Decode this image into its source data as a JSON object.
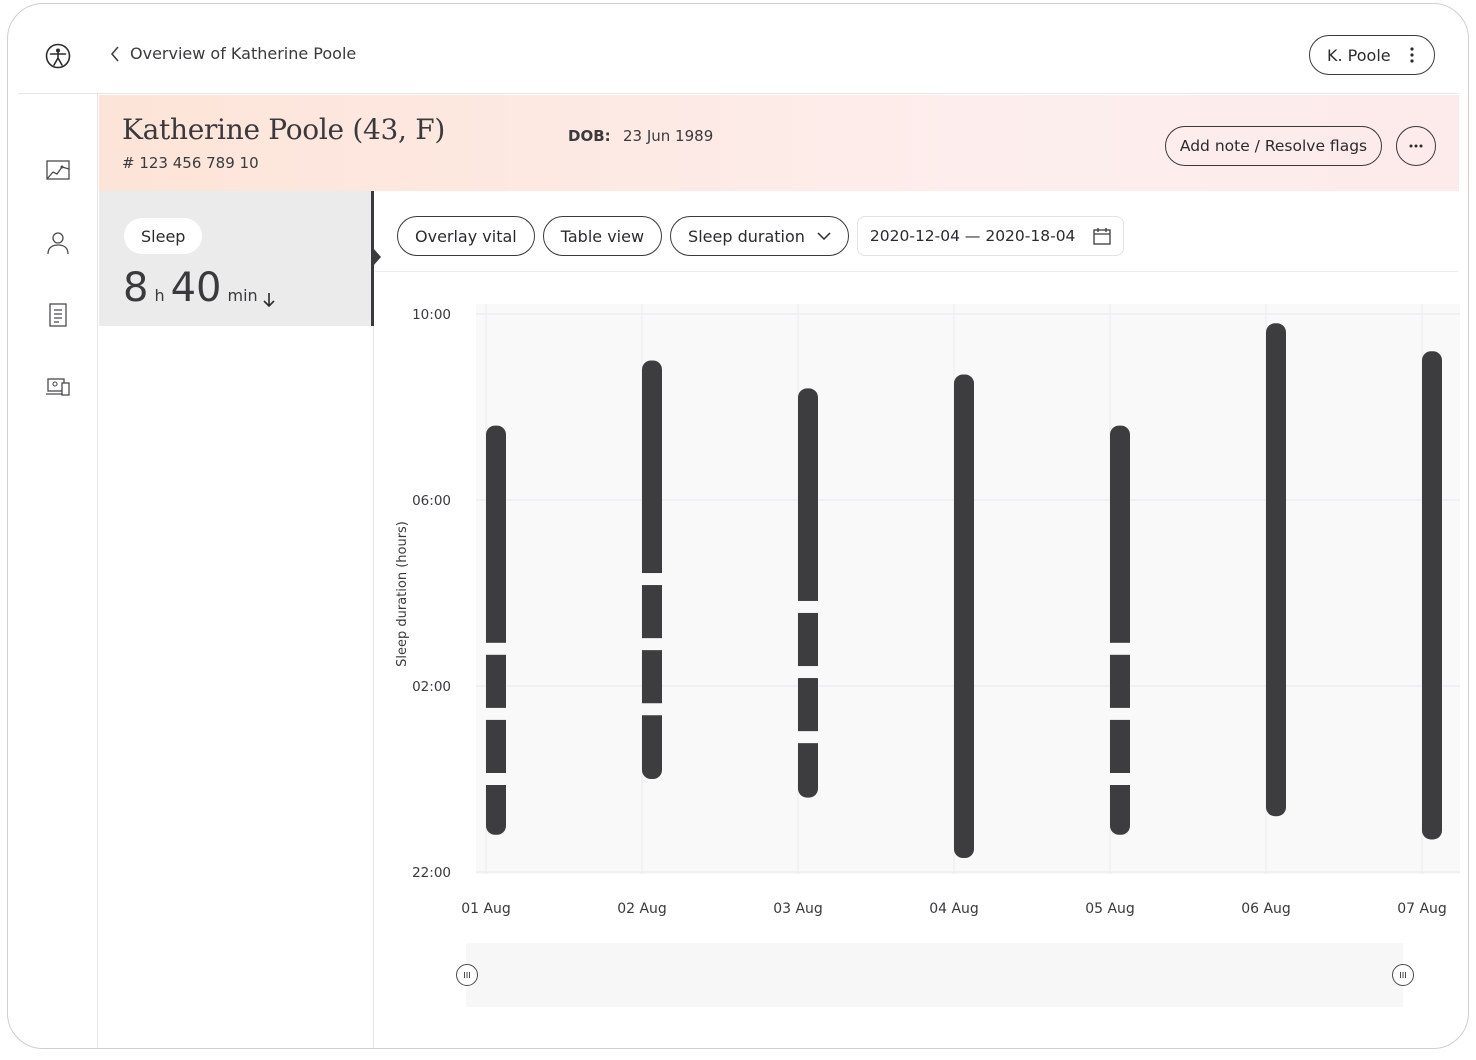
{
  "nav": {
    "back_label": "Overview of Katherine Poole",
    "user_pill": "K. Poole",
    "rail_icons": [
      "vitals-chart-icon",
      "person-icon",
      "document-icon",
      "devices-icon"
    ]
  },
  "patient": {
    "name": "Katherine Poole (43, F)",
    "id": "# 123 456 789 10",
    "dob_label": "DOB:",
    "dob_value": "23 Jun 1989",
    "add_note_label": "Add note / Resolve flags"
  },
  "vital_card": {
    "label": "Sleep",
    "hours": "8",
    "hours_unit": "h",
    "minutes": "40",
    "minutes_unit": "min",
    "trend": "down"
  },
  "toolbar": {
    "overlay_label": "Overlay vital",
    "table_label": "Table view",
    "metric_label": "Sleep duration",
    "date_range": "2020-12-04 — 2020-18-04"
  },
  "colors": {
    "bar": "#3d3d40",
    "header_gradient_start": "#fde4d8",
    "header_gradient_end": "#fdeaea",
    "plot_background": "#f9f9f9"
  },
  "chart_data": {
    "type": "bar",
    "ylabel": "Sleep duration (hours)",
    "y_ticks": [
      "10:00",
      "06:00",
      "02:00",
      "22:00"
    ],
    "y_tick_hours": [
      10,
      6,
      2,
      -2
    ],
    "ylim": [
      -2,
      10
    ],
    "categories": [
      "01 Aug",
      "02 Aug",
      "03 Aug",
      "04 Aug",
      "05 Aug",
      "06 Aug",
      "07 Aug"
    ],
    "bars": [
      {
        "start": -1.2,
        "end": 7.6,
        "gaps": [
          2.8,
          1.4,
          0.0
        ]
      },
      {
        "start": -0.0,
        "end": 9.0,
        "gaps": [
          4.3,
          2.9,
          1.5
        ]
      },
      {
        "start": -0.4,
        "end": 8.4,
        "gaps": [
          3.7,
          2.3,
          0.9
        ]
      },
      {
        "start": -1.7,
        "end": 8.7,
        "gaps": []
      },
      {
        "start": -1.2,
        "end": 7.6,
        "gaps": [
          2.8,
          1.4,
          0.0
        ]
      },
      {
        "start": -0.8,
        "end": 9.8,
        "gaps": []
      },
      {
        "start": -1.3,
        "end": 9.2,
        "gaps": []
      }
    ],
    "grid": true,
    "legend": "none"
  }
}
